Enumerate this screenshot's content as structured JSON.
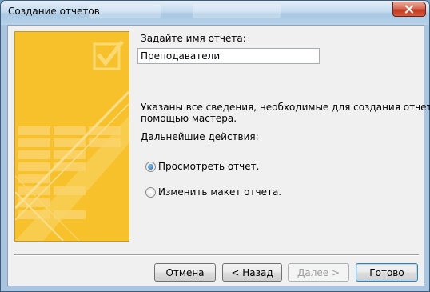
{
  "window": {
    "title": "Создание отчетов"
  },
  "form": {
    "name_label": "Задайте имя отчета:",
    "name_value": "Преподаватели",
    "info_line1": "Указаны все сведения, необходимые для создания отчета с",
    "info_line2": "помощью мастера.",
    "next_actions_label": "Дальнейшие действия:",
    "options": [
      {
        "label": "Просмотреть отчет.",
        "selected": true
      },
      {
        "label": "Изменить макет отчета.",
        "selected": false
      }
    ]
  },
  "buttons": {
    "cancel": "Отмена",
    "back": "< Назад",
    "next": "Далее >",
    "finish": "Готово"
  },
  "colors": {
    "banner": "#f6c12b",
    "titlebar": "#c4dbef",
    "close_button": "#c1391f",
    "dialog_background": "#f0f0f0"
  }
}
